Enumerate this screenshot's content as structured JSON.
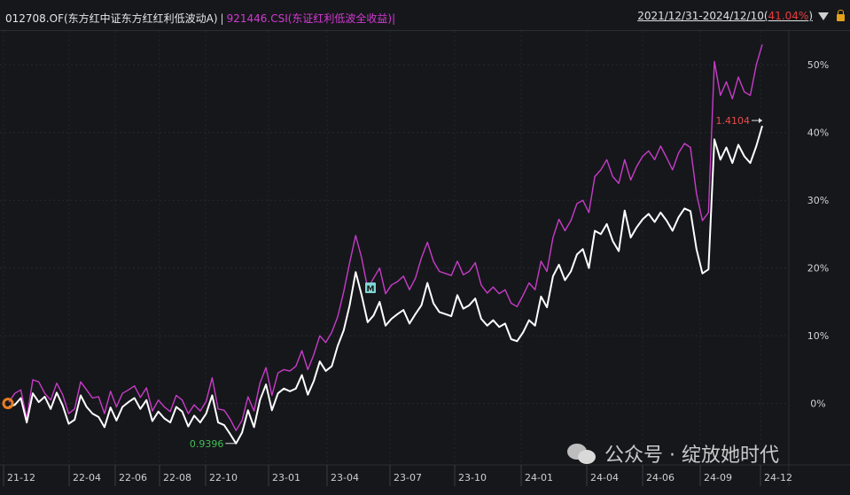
{
  "header": {
    "fund_label": "012708.OF(东方红中证东方红红利低波动A)",
    "separator": "|",
    "index_label": "921446.CSI(东证红利低波全收益)",
    "separator2": "|",
    "date_range": "2021/12/31-2024/12/10(",
    "range_return": "41.04%",
    "range_close": ")"
  },
  "watermark": {
    "text": "公众号 · 绽放她时代"
  },
  "colors": {
    "fund": "#ffffff",
    "index": "#c83cc8",
    "min_label": "#3fbf52",
    "max_label": "#e84a4a",
    "marker": "#7fd6d4"
  },
  "chart_data": {
    "type": "line",
    "x_ticks": [
      "21-12",
      "22-04",
      "22-06",
      "22-08",
      "22-10",
      "23-01",
      "23-04",
      "23-07",
      "23-10",
      "24-01",
      "24-04",
      "24-06",
      "24-09",
      "24-12"
    ],
    "y_ticks": [
      "0%",
      "10%",
      "20%",
      "30%",
      "40%",
      "50%"
    ],
    "ylim": [
      -7.5,
      55
    ],
    "grid": true,
    "legend": "top-left",
    "annotations": {
      "min_label": "0.9396",
      "max_label": "1.4104",
      "marker": "M"
    },
    "series": [
      {
        "name": "012708.OF(东方红中证东方红红利低波动A)",
        "values": [
          -0.5,
          -0.2,
          0.8,
          -2.8,
          1.5,
          0.2,
          1.0,
          -0.8,
          1.6,
          -0.3,
          -3.0,
          -2.4,
          1.2,
          -0.5,
          -1.5,
          -2.0,
          -3.5,
          -0.6,
          -2.5,
          -0.5,
          0.2,
          0.8,
          -0.8,
          0.5,
          -2.6,
          -1.2,
          -2.2,
          -2.8,
          -0.5,
          -1.2,
          -3.4,
          -1.8,
          -2.8,
          -1.5,
          1.2,
          -2.8,
          -3.2,
          -4.5,
          -5.9,
          -4.3,
          -1.0,
          -3.5,
          0.5,
          2.8,
          -1.0,
          1.5,
          2.2,
          1.8,
          2.2,
          4.2,
          1.3,
          3.3,
          6.2,
          4.8,
          5.5,
          8.5,
          10.8,
          14.5,
          19.4,
          16.0,
          12.0,
          13.0,
          15.0,
          11.5,
          12.5,
          13.2,
          13.8,
          11.8,
          13.2,
          14.5,
          17.8,
          14.8,
          13.5,
          13.2,
          12.9,
          16.0,
          14.0,
          14.5,
          15.5,
          12.5,
          11.5,
          12.3,
          11.3,
          11.8,
          9.5,
          9.2,
          10.5,
          12.3,
          11.5,
          15.8,
          14.2,
          18.8,
          20.5,
          18.2,
          19.5,
          22.0,
          22.8,
          20.0,
          25.5,
          25.0,
          26.5,
          24.0,
          22.5,
          28.5,
          24.5,
          26.0,
          27.2,
          28.0,
          26.8,
          28.2,
          27.0,
          25.5,
          27.5,
          28.8,
          28.4,
          22.8,
          19.2,
          19.8,
          39.0,
          36.0,
          37.8,
          35.5,
          38.2,
          36.5,
          35.5,
          38.0,
          41.0
        ]
      },
      {
        "name": "921446.CSI(东证红利低波全收益)",
        "values": [
          0.2,
          1.5,
          2.0,
          -2.2,
          3.5,
          3.2,
          1.5,
          0.5,
          3.0,
          1.3,
          -1.5,
          -0.8,
          3.2,
          2.0,
          0.8,
          1.0,
          -1.5,
          1.8,
          -0.5,
          1.5,
          2.0,
          2.6,
          0.9,
          2.3,
          -1.1,
          0.5,
          -0.5,
          -1.2,
          1.2,
          0.5,
          -1.5,
          -0.2,
          -1.1,
          0.3,
          3.8,
          -0.8,
          -1.0,
          -2.3,
          -4.0,
          -2.5,
          1.0,
          -1.1,
          3.0,
          5.3,
          1.2,
          4.5,
          5.0,
          4.8,
          5.5,
          7.8,
          5.0,
          7.2,
          10.0,
          9.0,
          10.5,
          12.8,
          16.5,
          20.8,
          24.8,
          21.5,
          17.0,
          18.5,
          20.0,
          16.2,
          17.5,
          18.0,
          18.8,
          16.8,
          18.5,
          21.5,
          23.8,
          21.0,
          19.5,
          19.2,
          18.9,
          21.0,
          19.0,
          19.5,
          20.8,
          17.5,
          16.3,
          17.2,
          16.2,
          16.8,
          14.8,
          14.3,
          16.0,
          17.8,
          16.8,
          21.0,
          19.5,
          24.5,
          27.2,
          25.5,
          27.0,
          29.5,
          30.0,
          28.2,
          33.5,
          34.5,
          36.0,
          33.5,
          32.5,
          36.0,
          33.0,
          35.0,
          36.5,
          37.3,
          36.0,
          38.0,
          36.3,
          34.5,
          37.0,
          38.4,
          37.8,
          31.0,
          27.0,
          28.2,
          50.5,
          45.5,
          47.5,
          45.0,
          48.2,
          46.0,
          45.5,
          50.0,
          53.0
        ]
      }
    ]
  }
}
